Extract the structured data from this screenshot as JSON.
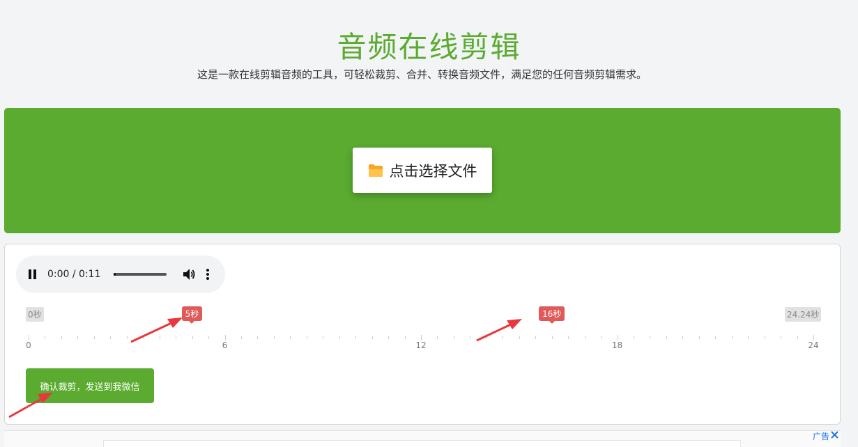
{
  "header": {
    "title": "音频在线剪辑",
    "subtitle": "这是一款在线剪辑音频的工具，可轻松裁剪、合并、转换音频文件，满足您的任何音频剪辑需求。"
  },
  "upload": {
    "button_label": "点击选择文件",
    "icon": "folder-icon"
  },
  "player": {
    "time": "0:00 / 0:11",
    "progress_fraction": 0.05,
    "icons": [
      "pause-icon",
      "volume-icon",
      "more-options-icon"
    ]
  },
  "timeline": {
    "start_label": "0秒",
    "end_label": "24.24秒",
    "handle_start_label": "5秒",
    "handle_end_label": "16秒",
    "handle_start_value": 5,
    "handle_end_value": 16,
    "duration": 24.24,
    "axis_max": 24,
    "tick_labels": [
      "0",
      "6",
      "12",
      "18",
      "24"
    ]
  },
  "actions": {
    "confirm_label": "确认裁剪，发送到我微信"
  },
  "ad": {
    "label": "广告",
    "close_icon": "close-icon"
  },
  "colors": {
    "brand_green": "#5aab30",
    "handle_red": "#e05a5a",
    "annotation_arrow": "#e8383d"
  }
}
